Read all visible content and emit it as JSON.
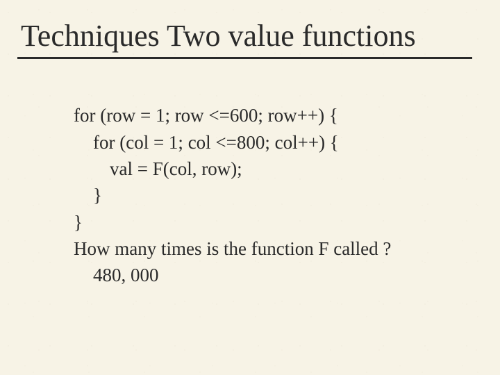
{
  "title": "Techniques Two value functions",
  "code": {
    "line1": "for (row = 1; row <=600; row++) {",
    "line2": "for (col = 1; col <=800; col++) {",
    "line3": "val = F(col, row);",
    "line4": "}",
    "line5": "}"
  },
  "question": "How many times is the function F called ?",
  "answer": "480, 000"
}
